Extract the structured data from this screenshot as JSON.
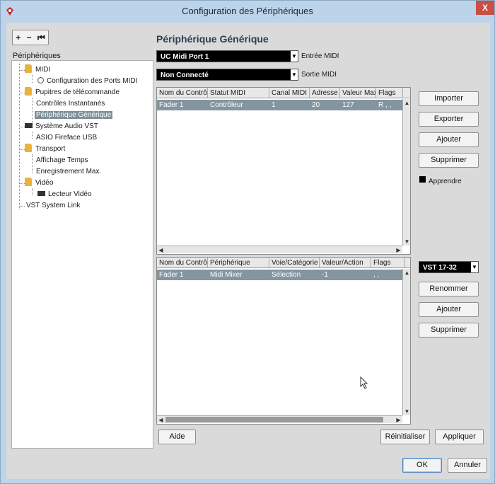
{
  "window": {
    "title": "Configuration des Périphériques",
    "close": "X"
  },
  "toolbar": {
    "add": "+",
    "remove": "−",
    "reset": "⏮"
  },
  "tree": {
    "label": "Périphériques",
    "items": [
      "MIDI",
      "Configuration des Ports MIDI",
      "Pupitres de télécommande",
      "Contrôles Instantanés",
      "Périphérique Générique",
      "Système Audio VST",
      "ASIO Fireface USB",
      "Transport",
      "Affichage Temps",
      "Enregistrement Max.",
      "Vidéo",
      "Lecteur Vidéo",
      "VST System Link"
    ]
  },
  "panel": {
    "title": "Périphérique Générique",
    "midi_in": {
      "value": "UC Midi Port 1",
      "label": "Entrée MIDI"
    },
    "midi_out": {
      "value": "Non Connecté",
      "label": "Sortie MIDI"
    }
  },
  "table1": {
    "headers": [
      "Nom du Contrôle",
      "Statut MIDI",
      "Canal MIDI",
      "Adresse",
      "Valeur Max.",
      "Flags"
    ],
    "rows": [
      [
        "Fader 1",
        "Contrôleur",
        "1",
        "20",
        "127",
        "R , ,"
      ]
    ]
  },
  "table2": {
    "headers": [
      "Nom du Contrôle",
      "Périphérique",
      "Voie/Catégorie",
      "Valeur/Action",
      "Flags"
    ],
    "rows": [
      [
        "Fader 1",
        "Midi Mixer",
        "Sélection",
        "-1",
        ", ,"
      ]
    ]
  },
  "buttons1": {
    "import": "Importer",
    "export": "Exporter",
    "add": "Ajouter",
    "delete": "Supprimer"
  },
  "learn": {
    "label": "Apprendre"
  },
  "bank": {
    "value": "VST 17-32"
  },
  "buttons2": {
    "rename": "Renommer",
    "add": "Ajouter",
    "delete": "Supprimer"
  },
  "footer": {
    "help": "Aide",
    "reset": "Réinitialiser",
    "apply": "Appliquer",
    "ok": "OK",
    "cancel": "Annuler"
  }
}
